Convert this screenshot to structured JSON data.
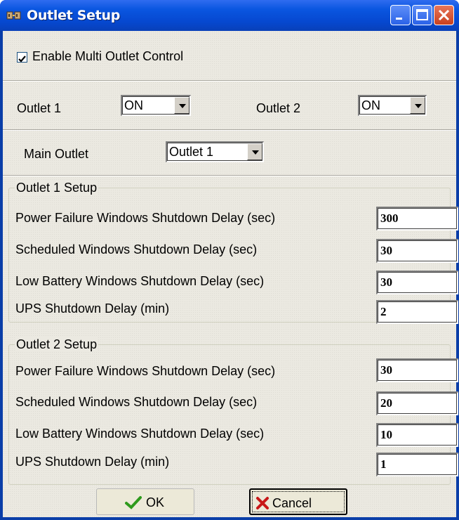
{
  "window": {
    "title": "Outlet Setup"
  },
  "controls": {
    "enable_multi_outlet_label": "Enable Multi Outlet Control",
    "enable_multi_outlet_checked": true,
    "outlet1_label": "Outlet 1",
    "outlet1_value": "ON",
    "outlet2_label": "Outlet 2",
    "outlet2_value": "ON",
    "main_outlet_label": "Main Outlet",
    "main_outlet_value": "Outlet 1"
  },
  "outlet1_setup": {
    "title": "Outlet 1 Setup",
    "rows": [
      {
        "label": "Power Failure Windows Shutdown Delay (sec)",
        "value": "300"
      },
      {
        "label": "Scheduled Windows Shutdown Delay (sec)",
        "value": "30"
      },
      {
        "label": "Low Battery Windows Shutdown Delay (sec)",
        "value": "30"
      },
      {
        "label": "UPS Shutdown Delay (min)",
        "value": "2"
      }
    ]
  },
  "outlet2_setup": {
    "title": "Outlet 2 Setup",
    "rows": [
      {
        "label": "Power Failure Windows Shutdown Delay (sec)",
        "value": "30"
      },
      {
        "label": "Scheduled Windows Shutdown Delay (sec)",
        "value": "20"
      },
      {
        "label": "Low Battery Windows Shutdown Delay (sec)",
        "value": "10"
      },
      {
        "label": "UPS Shutdown Delay (min)",
        "value": "1"
      }
    ]
  },
  "buttons": {
    "ok_label": "OK",
    "cancel_label": "Cancel"
  },
  "icons": {
    "title": "outlet-setup-icon",
    "ok": "checkmark-icon",
    "cancel": "x-icon"
  },
  "colors": {
    "titlebar": "#0648d0",
    "client": "#ebe9e1",
    "close_button": "#c8401e",
    "ok_check": "#2e9a1c",
    "cancel_x": "#c81818"
  }
}
